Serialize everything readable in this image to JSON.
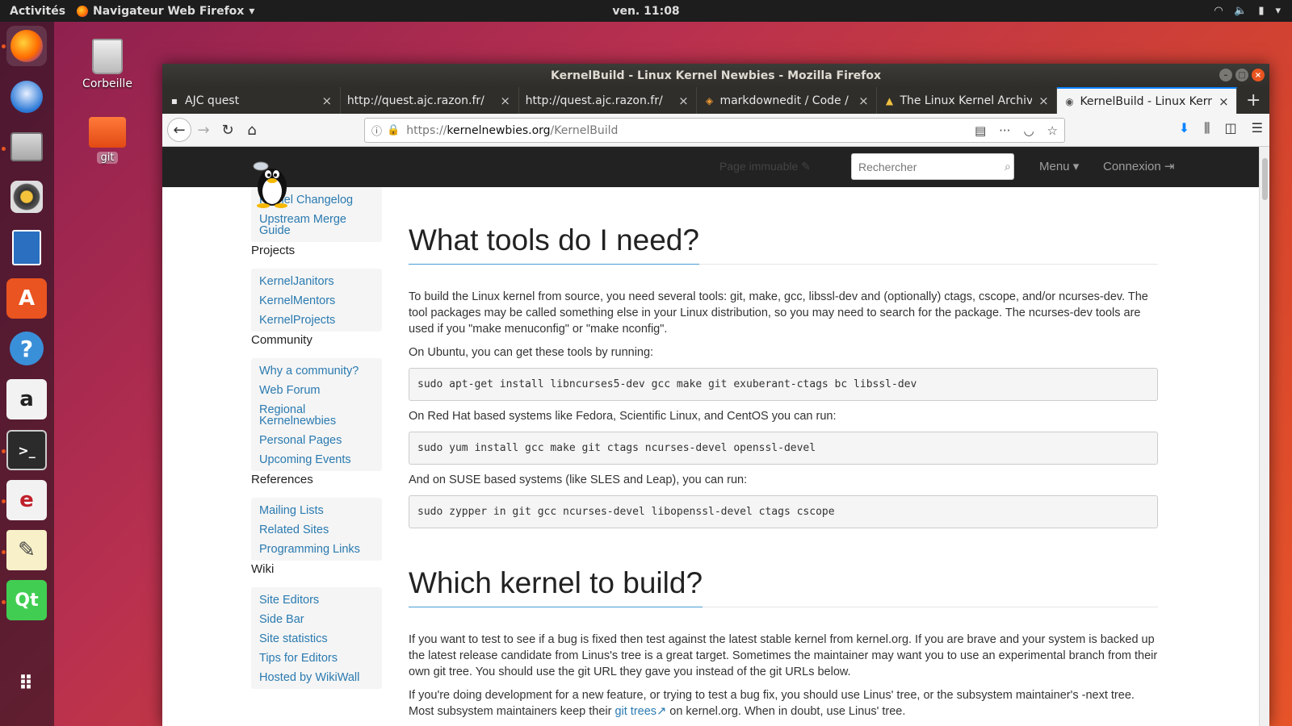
{
  "topbar": {
    "activities": "Activités",
    "app_menu": "Navigateur Web Firefox",
    "clock": "ven. 11:08"
  },
  "desktop": {
    "trash_label": "Corbeille",
    "folder_label": "git"
  },
  "window": {
    "title": "KernelBuild - Linux Kernel Newbies - Mozilla Firefox"
  },
  "tabs": [
    {
      "label": "AJC quest",
      "icon": "page-icon"
    },
    {
      "label": "http://quest.ajc.razon.fr/",
      "icon": ""
    },
    {
      "label": "http://quest.ajc.razon.fr/",
      "icon": ""
    },
    {
      "label": "markdownedit / Code / [",
      "icon": "code-icon"
    },
    {
      "label": "The Linux Kernel Archive",
      "icon": "tux-icon"
    },
    {
      "label": "KernelBuild - Linux Kerne",
      "icon": "kn-icon"
    }
  ],
  "urlbar": {
    "proto": "https://",
    "host": "kernelnewbies.org",
    "path": "/KernelBuild"
  },
  "site": {
    "readonly": "Page immuable ✎",
    "search_placeholder": "Rechercher",
    "menu": "Menu ▾",
    "login": "Connexion ⇥"
  },
  "sidebar": {
    "partial_link": "Kernel Changelog",
    "top_links": [
      "Kernel Changelog",
      "Upstream Merge Guide"
    ],
    "groups": [
      {
        "heading": "Projects",
        "links": [
          "KernelJanitors",
          "KernelMentors",
          "KernelProjects"
        ]
      },
      {
        "heading": "Community",
        "links": [
          "Why a community?",
          "Web Forum",
          "Regional Kernelnewbies",
          "Personal Pages",
          "Upcoming Events"
        ]
      },
      {
        "heading": "References",
        "links": [
          "Mailing Lists",
          "Related Sites",
          "Programming Links"
        ]
      },
      {
        "heading": "Wiki",
        "links": [
          "Site Editors",
          "Side Bar",
          "Site statistics",
          "Tips for Editors",
          "Hosted by WikiWall"
        ]
      }
    ]
  },
  "content": {
    "h1": "What tools do I need?",
    "p1": "To build the Linux kernel from source, you need several tools: git, make, gcc, libssl-dev and (optionally) ctags, cscope, and/or ncurses-dev. The tool packages may be called something else in your Linux distribution, so you may need to search for the package. The ncurses-dev tools are used if you \"make menuconfig\" or \"make nconfig\".",
    "p2": "On Ubuntu, you can get these tools by running:",
    "code1": "sudo apt-get install libncurses5-dev gcc make git exuberant-ctags bc libssl-dev",
    "p3": "On Red Hat based systems like Fedora, Scientific Linux, and CentOS you can run:",
    "code2": "sudo yum install gcc make git ctags ncurses-devel openssl-devel",
    "p4": "And on SUSE based systems (like SLES and Leap), you can run:",
    "code3": "sudo zypper in git gcc ncurses-devel libopenssl-devel ctags cscope",
    "h2": "Which kernel to build?",
    "p5": "If you want to test to see if a bug is fixed then test against the latest stable kernel from kernel.org. If you are brave and your system is backed up the latest release candidate from Linus's tree is a great target. Sometimes the maintainer may want you to use an experimental branch from their own git tree. You should use the git URL they gave you instead of the git URLs below.",
    "p6_before": "If you're doing development for a new feature, or trying to test a bug fix, you should use Linus' tree, or the subsystem maintainer's -next tree. Most subsystem maintainers keep their",
    "p6_link": "git trees",
    "p6_after": "on kernel.org. When in doubt, use Linus' tree."
  },
  "colors": {
    "accent": "#e95420",
    "link": "#2a7ab0",
    "tab_active": "#0a84ff"
  }
}
